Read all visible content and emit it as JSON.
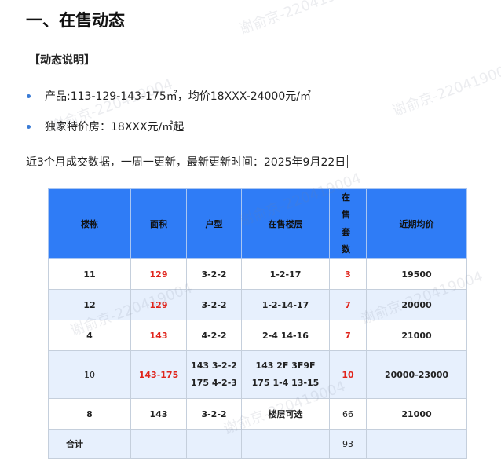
{
  "title": "一、在售动态",
  "section_label": "【动态说明】",
  "bullets": [
    "产品:113-129-143-175㎡，均价18XXX-24000元/㎡",
    "独家特价房：18XXX元/㎡起"
  ],
  "note": "近3个月成交数据，一周一更新，最新更新时间：2025年9月22日",
  "table": {
    "headers": [
      "楼栋",
      "面积",
      "户型",
      "在售楼层",
      "在 售",
      "套 数",
      "近期均价"
    ],
    "rows": [
      {
        "building": "11",
        "area": "129",
        "layout": "3-2-2",
        "floors": "1-2-17",
        "units": "3",
        "price": "19500"
      },
      {
        "building": "12",
        "area": "129",
        "layout": "3-2-2",
        "floors": "1-2-14-17",
        "units": "7",
        "price": "20000"
      },
      {
        "building": "4",
        "area": "143",
        "layout": "4-2-2",
        "floors": "2-4  14-16",
        "units": "7",
        "price": "21000"
      },
      {
        "building": "10",
        "area": "143-175",
        "layout1": "143 3-2-2",
        "layout2": "175 4-2-3",
        "floors1": "143 2F 3F9F",
        "floors2": "175 1-4  13-15",
        "units": "10",
        "price": "20000-23000"
      },
      {
        "building": "8",
        "area": "143",
        "layout": "3-2-2",
        "floors": "楼层可选",
        "units": "66",
        "price": "21000"
      }
    ],
    "total_label": "合计",
    "total_units": "93"
  },
  "watermark_text": "谢俞京-220419004",
  "colors": {
    "header_bg": "#2f7cf6",
    "alt_row": "#e7f0fd",
    "highlight": "#e0241b",
    "bullet": "#3a7bd5"
  }
}
